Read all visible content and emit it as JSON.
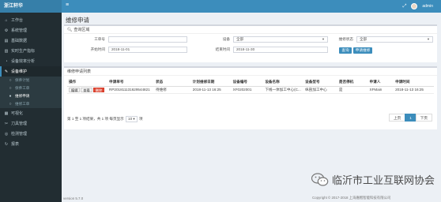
{
  "app": {
    "brand": "浙江轩华",
    "user": "admin"
  },
  "sidebar": {
    "items": [
      {
        "icon": "home-icon",
        "glyph": "⌂",
        "label": "工作台"
      },
      {
        "icon": "gear-icon",
        "glyph": "⚙",
        "label": "系统管理"
      },
      {
        "icon": "database-icon",
        "glyph": "▤",
        "label": "基础数据"
      },
      {
        "icon": "chart-icon",
        "glyph": "▥",
        "label": "实时生产指标"
      },
      {
        "icon": "analysis-icon",
        "glyph": "◔",
        "label": "设备效率分析"
      },
      {
        "icon": "wrench-icon",
        "glyph": "✎",
        "label": "设备维护"
      }
    ],
    "sub_items": [
      {
        "label": "保养计划"
      },
      {
        "label": "保养工单"
      },
      {
        "label": "维修申请"
      },
      {
        "label": "维修工单"
      }
    ],
    "bottom_items": [
      {
        "icon": "visual-icon",
        "glyph": "▦",
        "label": "可视化"
      },
      {
        "icon": "knife-icon",
        "glyph": "✂",
        "label": "刀具管理"
      },
      {
        "icon": "lab-icon",
        "glyph": "◎",
        "label": "检测管理"
      },
      {
        "icon": "report-icon",
        "glyph": "↻",
        "label": "报表"
      }
    ]
  },
  "page": {
    "title": "维修申请"
  },
  "search": {
    "header": "查询区域",
    "work_no_label": "工单号",
    "device_label": "设备",
    "device_value": "全部",
    "status_label": "维修状态",
    "status_value": "全部",
    "start_label": "开始时间",
    "start_value": "2018-11-01",
    "end_label": "结束时间",
    "end_value": "2018-11-30",
    "query_button": "查询",
    "apply_button": "申请维修"
  },
  "list": {
    "header": "维修申请列表",
    "columns": [
      "操作",
      "申请单号",
      "状态",
      "计划维修日期",
      "设备编号",
      "设备名称",
      "设备型号",
      "是否停机",
      "申请人",
      "申请时间"
    ],
    "rows": [
      {
        "actions": [
          "编辑",
          "查看",
          "删除"
        ],
        "apply_no": "RP201811131629544821",
        "status": "待维修",
        "plan_date": "2018-11-13 16:25",
        "device_no": "XF0202001",
        "device_name": "下线一体加工中心(C...",
        "device_model": "纵剖加工中心",
        "stopped": "是",
        "applicant": "XFMain",
        "apply_time": "2018-11-13 16:25"
      }
    ],
    "pager_info": "第 1 至 1 项结果，共 1 项 每页显示",
    "page_size": "10",
    "page_size_suffix": "项",
    "prev": "上页",
    "current_page": "1",
    "next": "下页"
  },
  "footer": {
    "version": "version 5.7.0",
    "copyright": "Copyright © 2017-2018 上海嘉楷智能科技有限公司"
  },
  "watermark": {
    "text": "临沂市工业互联网协会"
  },
  "colors": {
    "sidebar": "#222d32",
    "header": "#3c8dbc",
    "brand": "#367fa9",
    "danger": "#dd4b39"
  }
}
